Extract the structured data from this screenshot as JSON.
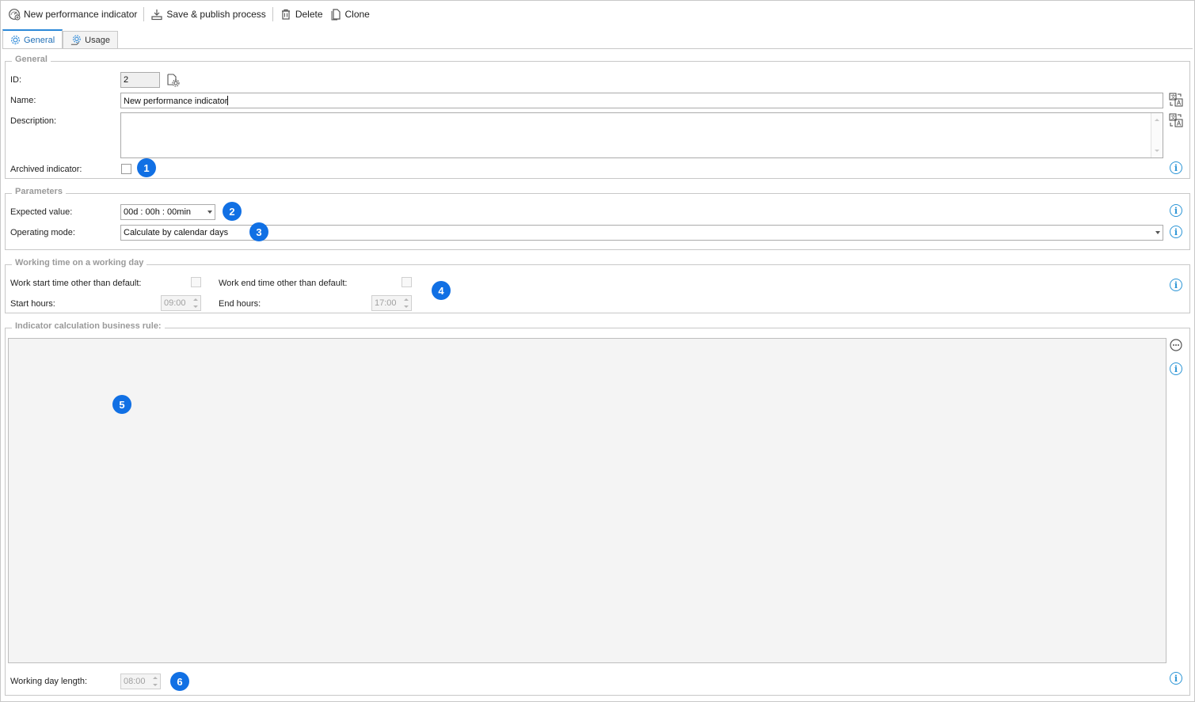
{
  "toolbar": {
    "new_label": "New performance indicator",
    "save_label": "Save & publish process",
    "delete_label": "Delete",
    "clone_label": "Clone"
  },
  "tabs": [
    {
      "label": "General",
      "active": true
    },
    {
      "label": "Usage",
      "active": false
    }
  ],
  "general": {
    "legend": "General",
    "id_label": "ID:",
    "id_value": "2",
    "name_label": "Name:",
    "name_value": "New performance indicator",
    "description_label": "Description:",
    "description_value": "",
    "archived_label": "Archived indicator:",
    "archived_checked": false
  },
  "parameters": {
    "legend": "Parameters",
    "expected_label": "Expected value:",
    "expected_value": "00d : 00h : 00min",
    "operating_label": "Operating mode:",
    "operating_value": "Calculate by calendar days"
  },
  "working_time": {
    "legend": "Working time on a working day",
    "start_other_label": "Work start time other than default:",
    "end_other_label": "Work end time other than default:",
    "start_hours_label": "Start hours:",
    "start_hours_value": "09:00",
    "end_hours_label": "End hours:",
    "end_hours_value": "17:00"
  },
  "business_rule": {
    "legend": "Indicator calculation business rule:",
    "day_length_label": "Working day length:",
    "day_length_value": "08:00"
  },
  "badges": [
    "1",
    "2",
    "3",
    "4",
    "5",
    "6"
  ],
  "info_glyph": "i",
  "colors": {
    "accent": "#2b88d8",
    "badge": "#1170e4",
    "info": "#2b95d6",
    "legend_text": "#9a9a9a",
    "rule_area_bg": "#f4f4f4"
  },
  "icons": {
    "new": "gauge-plus-icon",
    "save": "save-publish-icon",
    "delete": "trash-icon",
    "clone": "copy-icon",
    "general_tab": "gear-icon",
    "usage_tab": "gears-usage-icon",
    "id_action": "document-gear-icon",
    "translate": "translate-icon",
    "more": "ellipsis-circle-icon",
    "info": "info-icon"
  }
}
